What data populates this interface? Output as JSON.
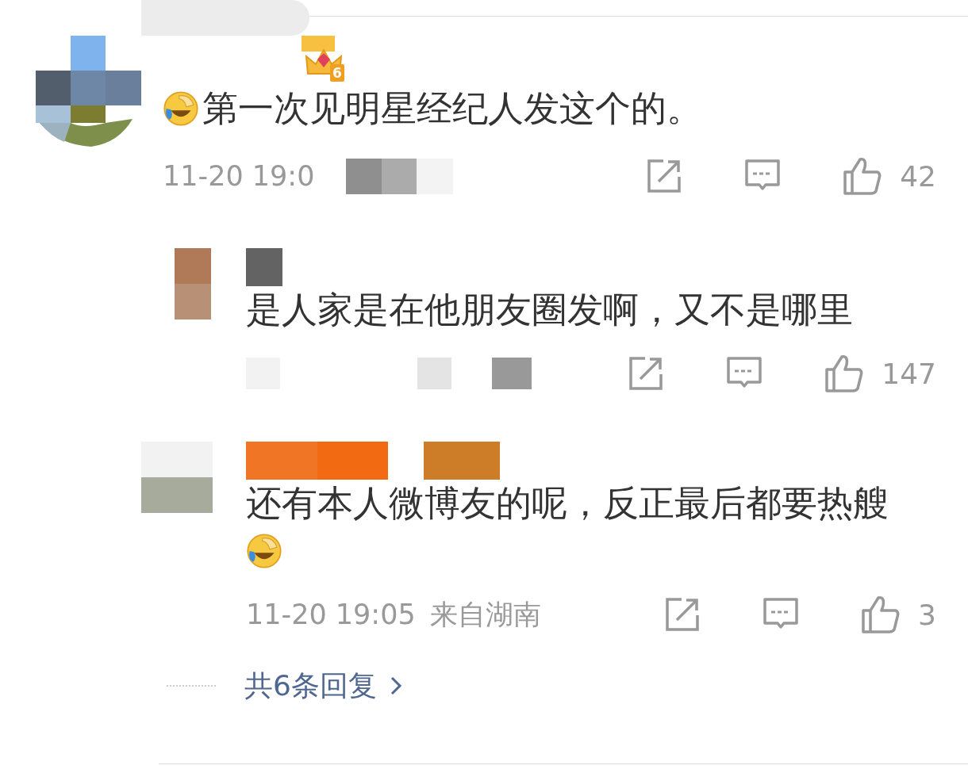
{
  "comment": {
    "badge_level": "6",
    "leading_emoji": true,
    "text": "第一次见明星经纪人发这个的。",
    "time": "11-20 19:0",
    "likes": "42"
  },
  "replies": [
    {
      "text": "是人家是在他朋友圈发啊，又不是哪里",
      "trailing_emoji": false,
      "likes": "147"
    },
    {
      "text": "还有本人微博友的呢，反正最后都要热艘",
      "trailing_emoji": true,
      "time": "11-20 19:05",
      "location": "来自湖南",
      "likes": "3"
    }
  ],
  "more_replies": "共6条回复"
}
